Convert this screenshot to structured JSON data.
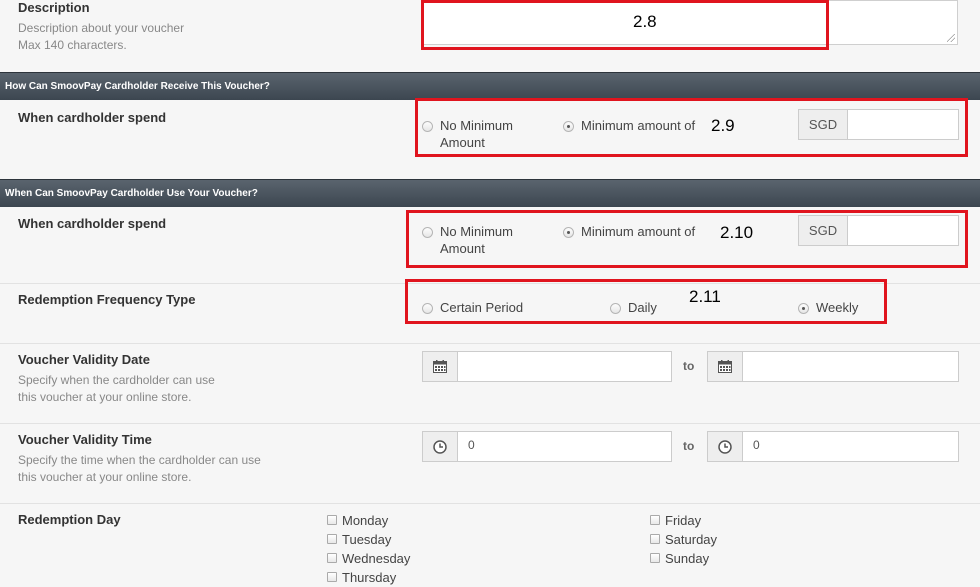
{
  "description": {
    "label": "Description",
    "help_line1": "Description about your voucher",
    "help_line2": "Max 140 characters.",
    "annotation": "2.8"
  },
  "section_receive": {
    "title": "How Can SmoovPay Cardholder Receive This Voucher?",
    "spend_label": "When cardholder spend",
    "opt_no_min_line1": "No Minimum",
    "opt_no_min_line2": "Amount",
    "opt_min_amount": "Minimum amount of",
    "currency": "SGD",
    "amount_value": "",
    "annotation": "2.9"
  },
  "section_use": {
    "title": "When Can SmoovPay Cardholder Use Your Voucher?",
    "spend_label": "When cardholder spend",
    "opt_no_min_line1": "No Minimum",
    "opt_no_min_line2": "Amount",
    "opt_min_amount": "Minimum amount of",
    "currency": "SGD",
    "amount_value": "",
    "annotation": "2.10"
  },
  "frequency": {
    "label": "Redemption Frequency Type",
    "options": [
      "Certain Period",
      "Daily",
      "Weekly"
    ],
    "selected": "Weekly",
    "annotation": "2.11"
  },
  "validity_date": {
    "label": "Voucher Validity Date",
    "help_line1": "Specify when the cardholder can use",
    "help_line2": "this voucher at your online store.",
    "to": "to",
    "from_value": "",
    "to_value": ""
  },
  "validity_time": {
    "label": "Voucher Validity Time",
    "help_line1": "Specify the time when the cardholder can use",
    "help_line2": "this voucher at your online store.",
    "to": "to",
    "from_value": "0",
    "to_value": "0"
  },
  "redemption_day": {
    "label": "Redemption Day",
    "days_left": [
      "Monday",
      "Tuesday",
      "Wednesday",
      "Thursday"
    ],
    "days_right": [
      "Friday",
      "Saturday",
      "Sunday"
    ]
  },
  "colors": {
    "annotation_red": "#e0141e",
    "section_bar": "#4a545e"
  },
  "icons": {
    "calendar": "calendar-icon",
    "clock": "clock-icon"
  }
}
